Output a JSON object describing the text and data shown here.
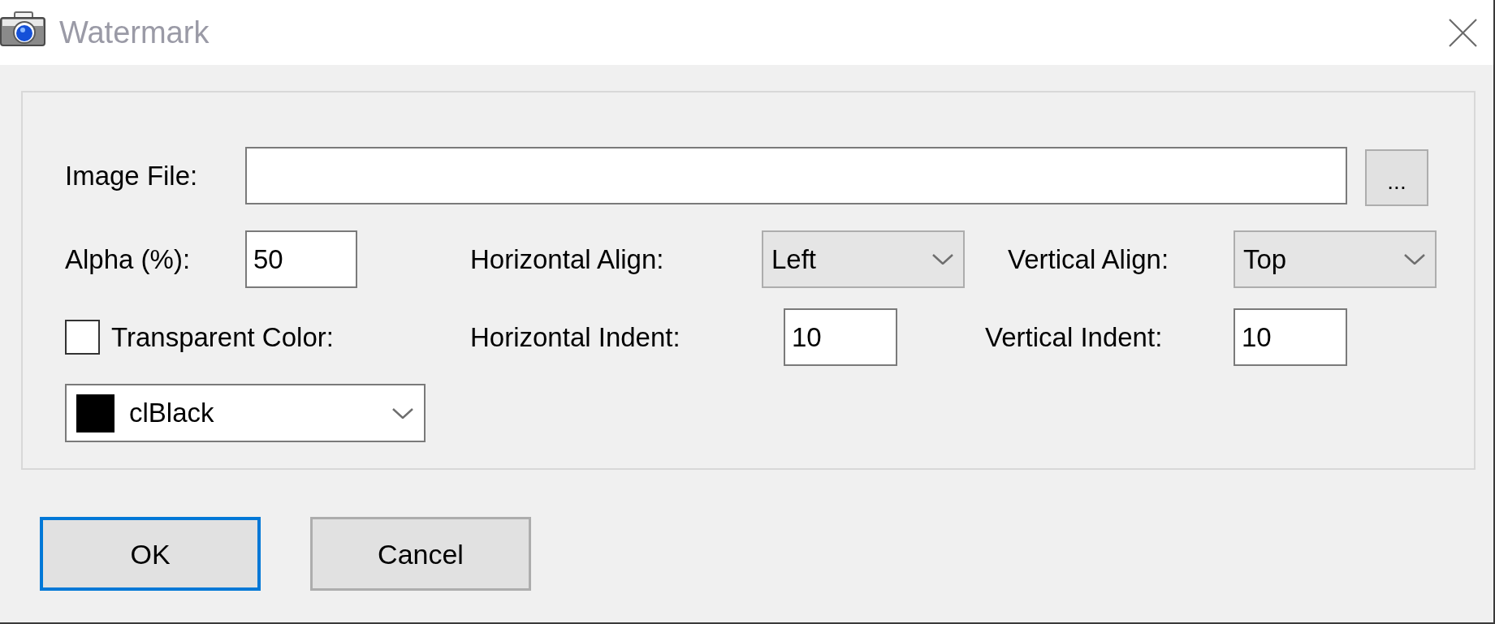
{
  "window": {
    "title": "Watermark"
  },
  "image_file": {
    "label": "Image File:",
    "browse_button": "..."
  },
  "alpha": {
    "label": "Alpha (%):",
    "value": "50"
  },
  "horizontal_align": {
    "label": "Horizontal Align:",
    "value": "Left"
  },
  "vertical_align": {
    "label": "Vertical Align:",
    "value": "Top"
  },
  "transparent_color": {
    "label": "Transparent Color:",
    "checked": false,
    "value": "clBlack",
    "color": "#000000"
  },
  "horizontal_indent": {
    "label": "Horizontal Indent:",
    "value": "10"
  },
  "vertical_indent": {
    "label": "Vertical Indent:",
    "value": "10"
  },
  "buttons": [
    {
      "label": "OK",
      "focused": true
    },
    {
      "label": "Cancel",
      "focused": false
    }
  ]
}
